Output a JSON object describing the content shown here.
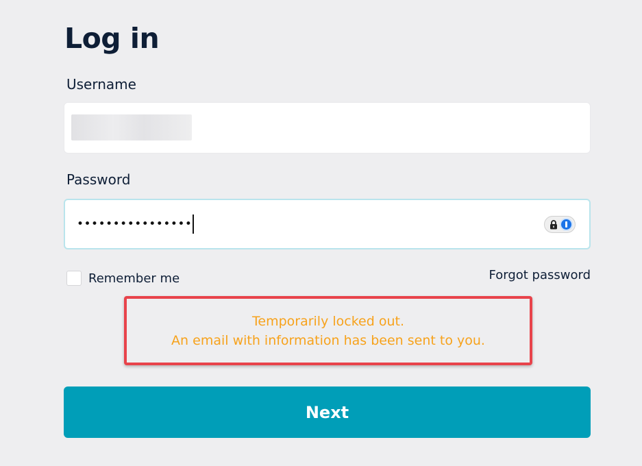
{
  "page": {
    "title": "Log in"
  },
  "form": {
    "username": {
      "label": "Username",
      "value_redacted": true
    },
    "password": {
      "label": "Password",
      "masked_value": "••••••••••••••••",
      "manager_icon": "password-manager-icon"
    },
    "remember_me": {
      "label": "Remember me",
      "checked": false
    },
    "forgot_password": "Forgot password",
    "alert": {
      "line1": "Temporarily locked out.",
      "line2": "An email with information has been sent to you.",
      "text_color": "#f7a21b",
      "border_color": "#e8434b"
    },
    "submit_label": "Next"
  },
  "colors": {
    "background": "#eeeef0",
    "primary": "#009eb8",
    "text": "#0e1e36",
    "focus_border": "#b9e4ec"
  }
}
